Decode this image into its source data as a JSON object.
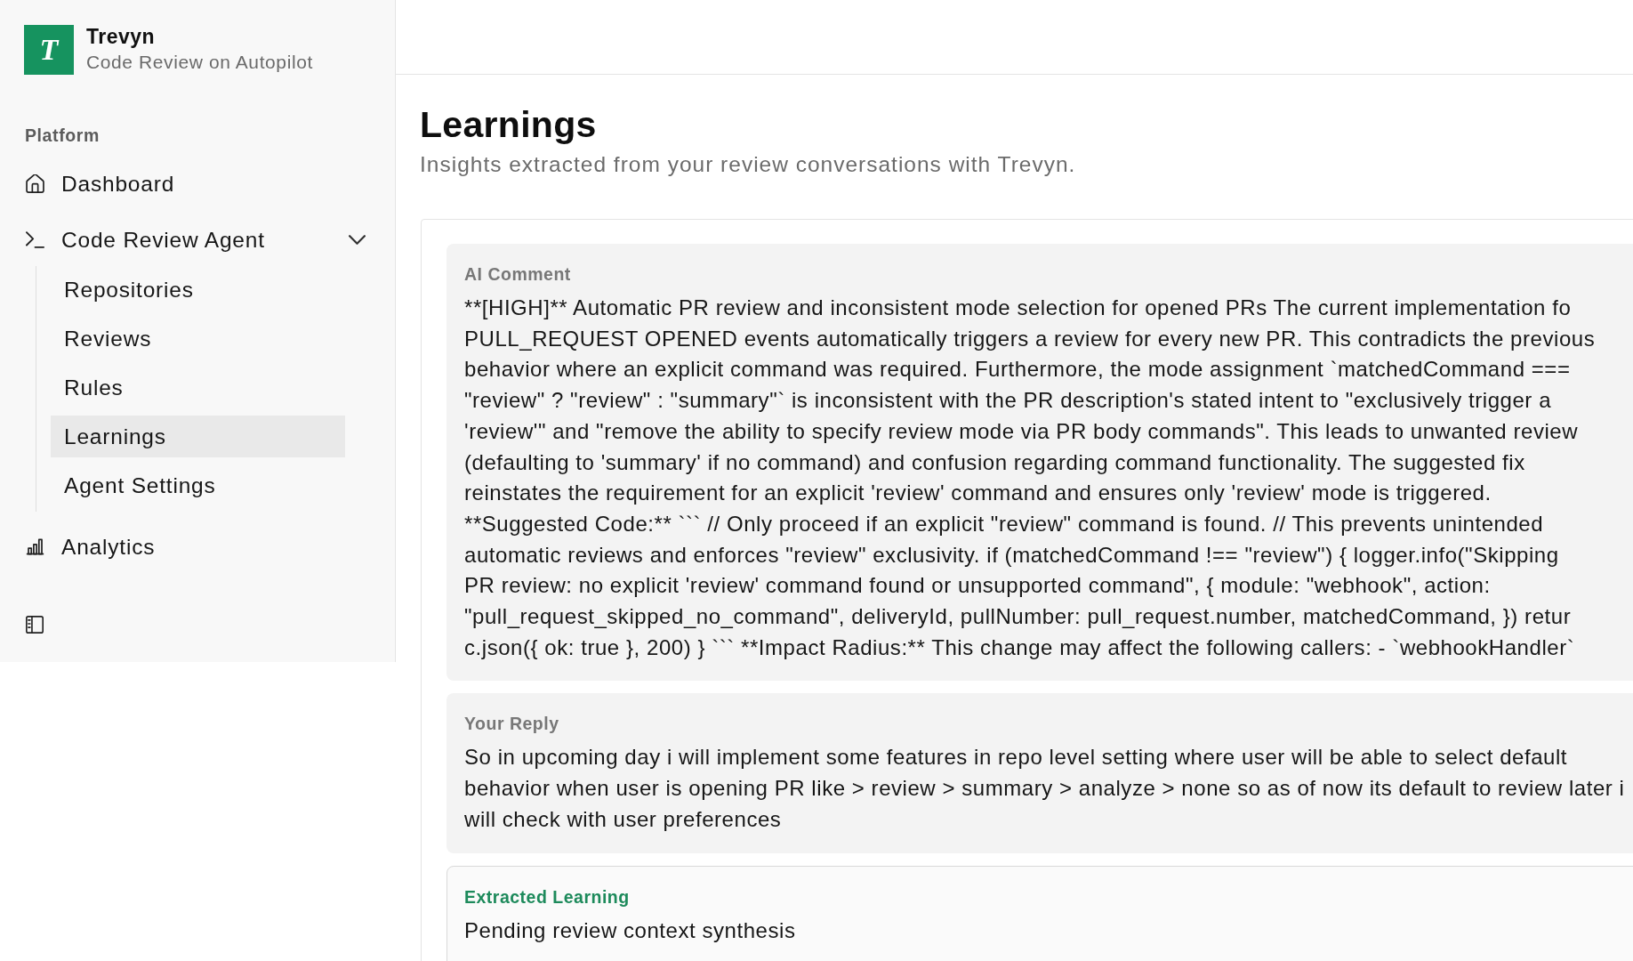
{
  "brand": {
    "logo_letter": "T",
    "name": "Trevyn",
    "tagline": "Code Review on Autopilot"
  },
  "sidebar": {
    "section_label": "Platform",
    "items": [
      {
        "label": "Dashboard",
        "selected": false
      },
      {
        "label": "Code Review Agent",
        "selected": false,
        "expanded": true,
        "children": [
          {
            "label": "Repositories",
            "selected": false
          },
          {
            "label": "Reviews",
            "selected": false
          },
          {
            "label": "Rules",
            "selected": false
          },
          {
            "label": "Learnings",
            "selected": true
          },
          {
            "label": "Agent Settings",
            "selected": false
          }
        ]
      },
      {
        "label": "Analytics",
        "selected": false
      }
    ]
  },
  "page": {
    "title": "Learnings",
    "subtitle": "Insights extracted from your review conversations with Trevyn."
  },
  "learning": {
    "sections": [
      {
        "kind": "comment",
        "label": "AI Comment",
        "lines": [
          "**[HIGH]** Automatic PR review and inconsistent mode selection for opened PRs The current implementation fo",
          "PULL_REQUEST OPENED events automatically triggers a review for every new PR. This contradicts the previous",
          "behavior where an explicit command was required. Furthermore, the mode assignment `matchedCommand ===",
          "\"review\" ? \"review\" : \"summary\"` is inconsistent with the PR description's stated intent to \"exclusively trigger a",
          "'review'\" and \"remove the ability to specify review mode via PR body commands\". This leads to unwanted review",
          "(defaulting to 'summary' if no command) and confusion regarding command functionality. The suggested fix",
          "reinstates the requirement for an explicit 'review' command and ensures only 'review' mode is triggered.",
          "**Suggested Code:** ``` // Only proceed if an explicit \"review\" command is found. // This prevents unintended",
          "automatic reviews and enforces \"review\" exclusivity. if (matchedCommand !== \"review\") { logger.info(\"Skipping",
          "PR review: no explicit 'review' command found or unsupported command\", { module: \"webhook\", action:",
          "\"pull_request_skipped_no_command\", deliveryId, pullNumber: pull_request.number, matchedCommand, }) retur",
          "c.json({ ok: true }, 200) } ``` **Impact Radius:** This change may affect the following callers: - `webhookHandler`"
        ]
      },
      {
        "kind": "reply",
        "label": "Your Reply",
        "text": "So in upcoming day i will implement some features in repo level setting where user will be able to select default behavior when user is opening PR like > review > summary > analyze > none so as of now its default to review later i will check with user preferences"
      },
      {
        "kind": "extracted",
        "label": "Extracted Learning",
        "text": "Pending review context synthesis"
      }
    ]
  }
}
